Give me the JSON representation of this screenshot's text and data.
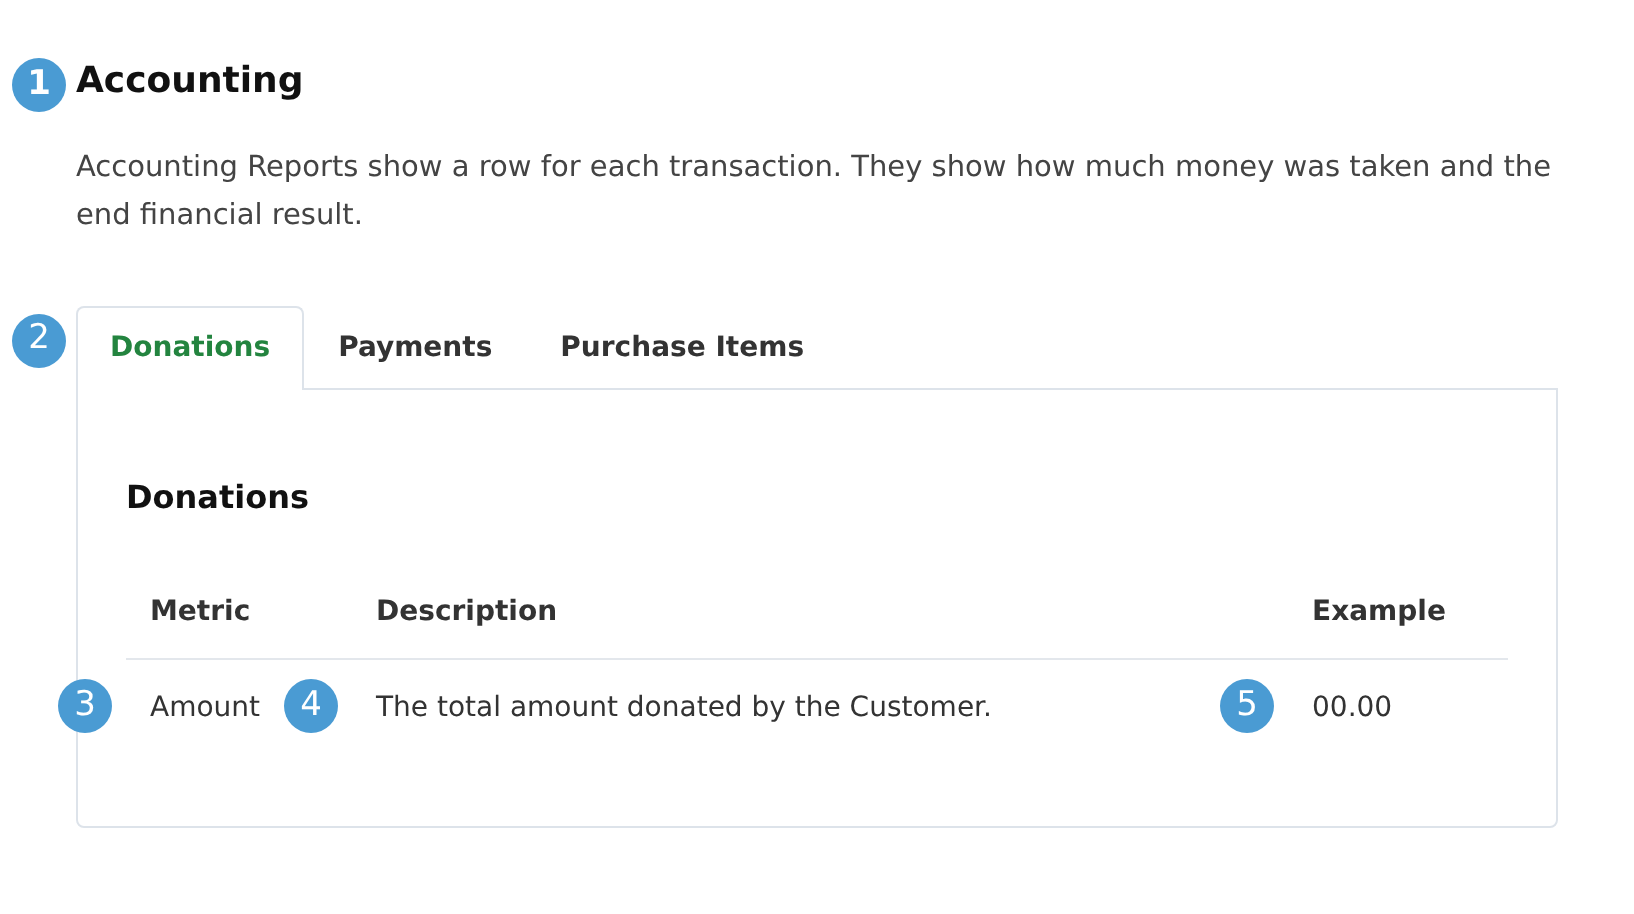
{
  "heading": {
    "marker": "1",
    "text": "Accounting"
  },
  "intro": "Accounting Reports show a row for each transaction. They show how much money was taken and the end financial result.",
  "tabs_marker": "2",
  "tabs": [
    {
      "label": "Donations",
      "selected": true
    },
    {
      "label": "Payments",
      "selected": false
    },
    {
      "label": "Purchase Items",
      "selected": false
    }
  ],
  "panel": {
    "title": "Donations",
    "columns": [
      "Metric",
      "Description",
      "Example"
    ],
    "rows": [
      [
        {
          "marker": "3",
          "text": "Amount"
        },
        {
          "marker": "4",
          "text": "The total amount donated by the Customer."
        },
        {
          "marker": "5",
          "text": "00.00"
        }
      ]
    ]
  }
}
